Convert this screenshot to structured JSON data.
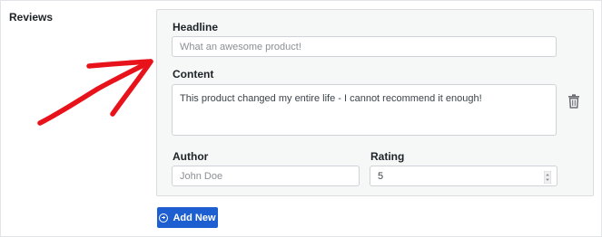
{
  "section": {
    "label": "Reviews"
  },
  "review": {
    "headline_label": "Headline",
    "headline_placeholder": "What an awesome product!",
    "content_label": "Content",
    "content_value": "This product changed my entire life - I cannot recommend it enough!",
    "author_label": "Author",
    "author_placeholder": "John Doe",
    "rating_label": "Rating",
    "rating_value": "5"
  },
  "actions": {
    "add_new_label": "Add New"
  },
  "icons": {
    "delete": "trash-icon",
    "add": "plus-circle-icon",
    "annotation": "red-arrow-annotation",
    "stepper": "number-stepper-icon"
  },
  "colors": {
    "accent": "#1d5fd1",
    "annotation": "#e8121b",
    "card_bg": "#f6f7f7"
  }
}
